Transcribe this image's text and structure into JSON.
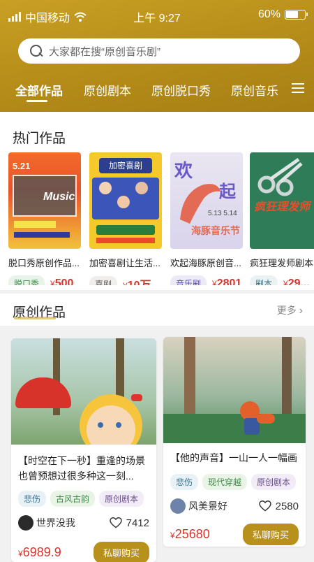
{
  "status_bar": {
    "carrier": "中国移动",
    "time": "上午 9:27",
    "battery": "60%"
  },
  "search": {
    "placeholder": "大家都在搜“原创音乐剧”"
  },
  "tabs": [
    "全部作品",
    "原创剧本",
    "原创脱口秀",
    "原创音乐"
  ],
  "hot": {
    "title": "热门作品",
    "items": [
      {
        "title": "脱口秀原创作品...",
        "tag": "脱口秀",
        "price": "500"
      },
      {
        "title": "加密喜剧让生活...",
        "tag": "喜剧",
        "price": "10万"
      },
      {
        "title": "欢起海豚原创音...",
        "tag": "音乐剧",
        "price": "2801"
      },
      {
        "title": "疯狂理发师剧本",
        "tag": "剧本",
        "price": "29..."
      }
    ]
  },
  "original": {
    "title": "原创作品",
    "more": "更多",
    "cards": [
      {
        "title": "【时空在下一秒】重逢的场景也曾预想过很多种这一刻...",
        "tags": [
          "悲伤",
          "古风古韵",
          "原创剧本"
        ],
        "user": "世界没我",
        "likes": "7412",
        "price": "6989.9",
        "buy": "私聊购买"
      },
      {
        "title": "【他的声音】一山一人一幅画",
        "tags": [
          "悲伤",
          "现代穿越",
          "原创剧本"
        ],
        "user": "风美景好",
        "likes": "2580",
        "price": "25680",
        "buy": "私聊购买"
      }
    ]
  },
  "poster_text": {
    "p1_date": "5.21",
    "p1_word": "Music",
    "p2_head": "加密喜剧",
    "p3_big": "欢",
    "p3_big2": "起",
    "p3_sub": "海豚音乐节",
    "p3_dates": "5.13 5.14",
    "p4_title": "疯狂理发师"
  },
  "colors": {
    "brand": "#b8901c",
    "price": "#d6342d"
  }
}
